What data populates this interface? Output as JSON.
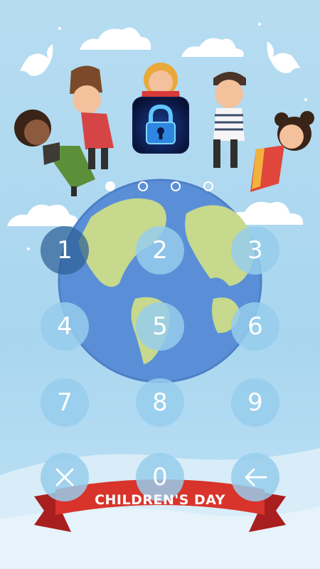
{
  "passcode": {
    "dots": [
      {
        "state": "filled"
      },
      {
        "state": "empty"
      },
      {
        "state": "empty"
      },
      {
        "state": "empty"
      }
    ],
    "keys": [
      {
        "label": "1",
        "name": "key-1",
        "active": true
      },
      {
        "label": "2",
        "name": "key-2"
      },
      {
        "label": "3",
        "name": "key-3"
      },
      {
        "label": "4",
        "name": "key-4"
      },
      {
        "label": "5",
        "name": "key-5"
      },
      {
        "label": "6",
        "name": "key-6"
      },
      {
        "label": "7",
        "name": "key-7"
      },
      {
        "label": "8",
        "name": "key-8"
      },
      {
        "label": "9",
        "name": "key-9"
      },
      {
        "icon": "close-icon",
        "name": "clear-button"
      },
      {
        "label": "0",
        "name": "key-0"
      },
      {
        "icon": "backspace-arrow-icon",
        "name": "backspace-button"
      }
    ]
  },
  "banner": {
    "text": "CHILDREN'S DAY"
  },
  "lock_icon": "padlock-icon",
  "colors": {
    "background": "#b6dcf1",
    "key_fill": "#96cdec",
    "key_active": "#2e6096",
    "ribbon": "#d9342b",
    "ocean": "#5a8fd8",
    "land": "#c7d98c"
  }
}
